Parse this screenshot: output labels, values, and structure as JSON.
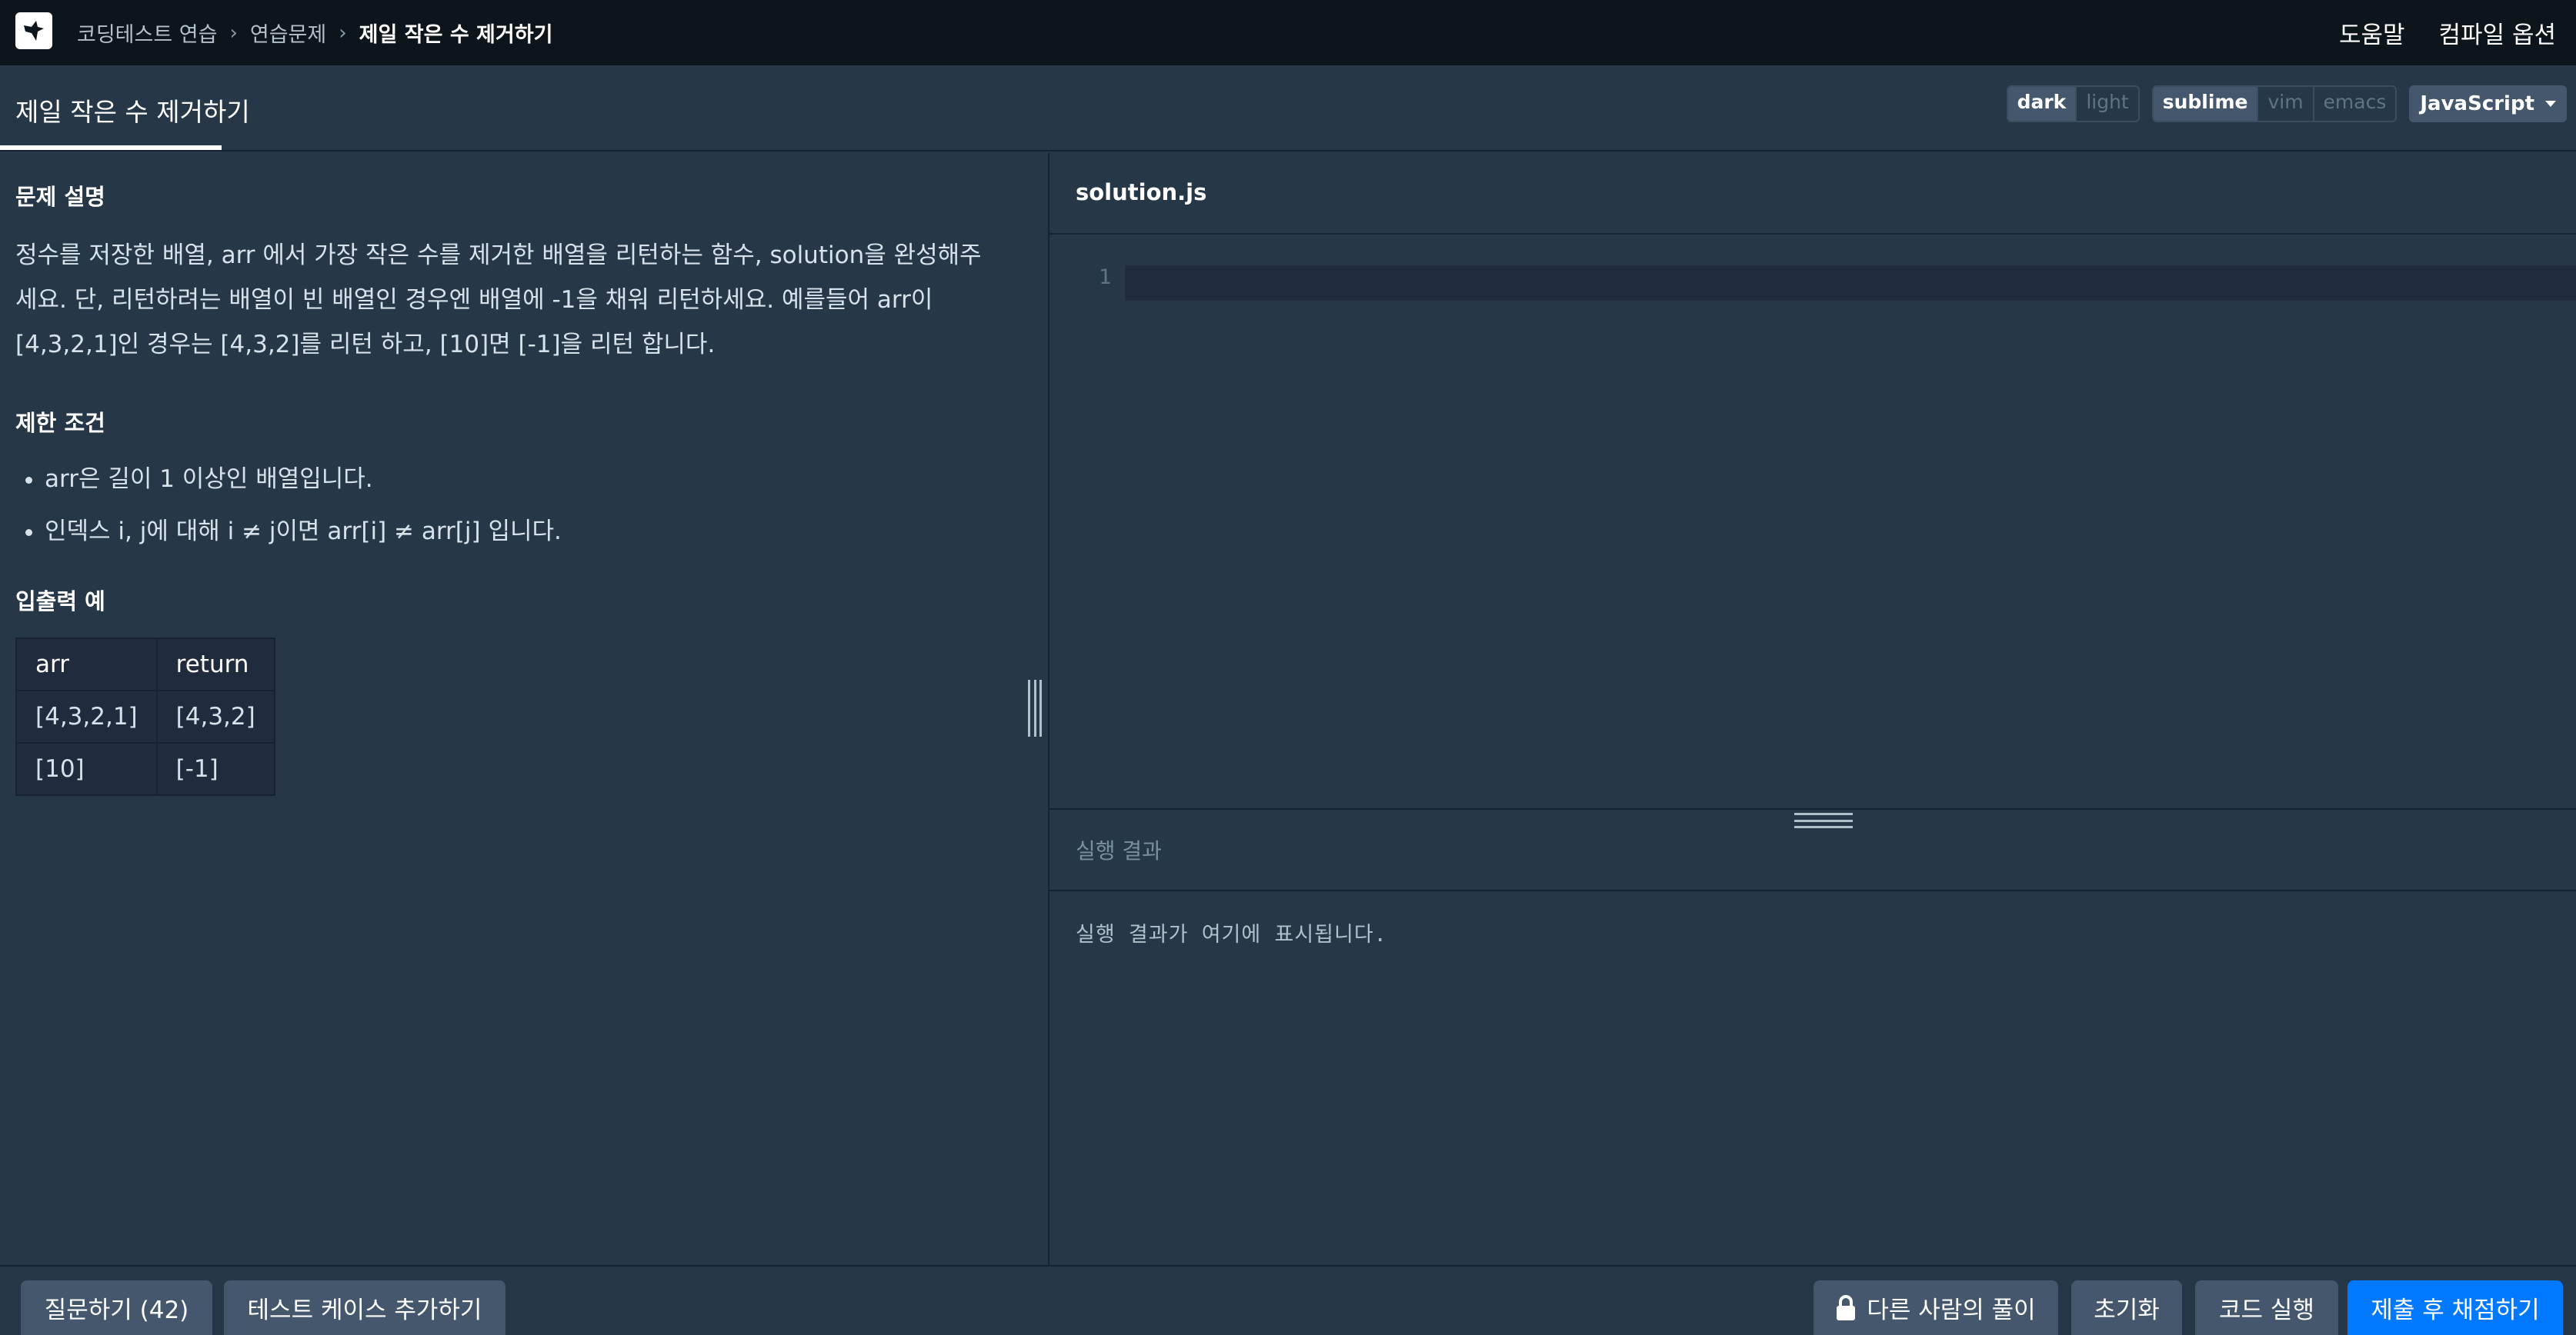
{
  "nav": {
    "breadcrumb": [
      "코딩테스트 연습",
      "연습문제",
      "제일 작은 수 제거하기"
    ],
    "help": "도움말",
    "compile_options": "컴파일 옵션"
  },
  "tab": {
    "title": "제일 작은 수 제거하기"
  },
  "toggles": {
    "theme": [
      "dark",
      "light"
    ],
    "theme_selected": "dark",
    "keymap": [
      "sublime",
      "vim",
      "emacs"
    ],
    "keymap_selected": "sublime",
    "language": "JavaScript"
  },
  "problem": {
    "desc_title": "문제 설명",
    "desc_lines": [
      "정수를 저장한 배열, arr 에서 가장 작은 수를 제거한 배열을 리턴하는 함수, solution을 완성해주",
      "세요. 단, 리턴하려는 배열이 빈 배열인 경우엔 배열에 -1을 채워 리턴하세요. 예를들어 arr이",
      "[4,3,2,1]인 경우는 [4,3,2]를 리턴 하고, [10]면 [-1]을 리턴 합니다."
    ],
    "constraints_title": "제한 조건",
    "constraints": [
      "arr은 길이 1 이상인 배열입니다.",
      "인덱스 i, j에 대해 i ≠ j이면 arr[i] ≠ arr[j] 입니다."
    ],
    "examples_title": "입출력 예",
    "examples": {
      "headers": [
        "arr",
        "return"
      ],
      "rows": [
        [
          "[4,3,2,1]",
          "[4,3,2]"
        ],
        [
          "[10]",
          "[-1]"
        ]
      ]
    }
  },
  "editor": {
    "filename": "solution.js",
    "line_number": "1"
  },
  "result": {
    "title": "실행 결과",
    "placeholder": "실행 결과가 여기에 표시됩니다."
  },
  "bottom": {
    "ask": "질문하기 (42)",
    "add_testcase": "테스트 케이스 추가하기",
    "others_solutions": "다른 사람의 풀이",
    "reset": "초기화",
    "run": "코드 실행",
    "submit": "제출 후 채점하기"
  },
  "colors": {
    "background": "#263747",
    "nav_background": "#0c151c",
    "button": "#44576c",
    "primary": "#0078ff"
  }
}
